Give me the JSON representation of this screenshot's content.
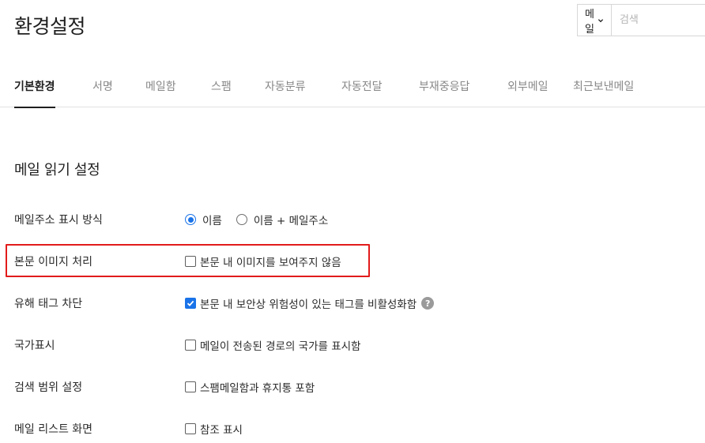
{
  "header": {
    "title": "환경설정",
    "search": {
      "scope_selected": "메일",
      "placeholder": "검색",
      "value": ""
    }
  },
  "tabs": [
    {
      "label": "기본환경",
      "active": true
    },
    {
      "label": "서명",
      "active": false
    },
    {
      "label": "메일함",
      "active": false
    },
    {
      "label": "스팸",
      "active": false
    },
    {
      "label": "자동분류",
      "active": false
    },
    {
      "label": "자동전달",
      "active": false
    },
    {
      "label": "부재중응답",
      "active": false
    },
    {
      "label": "외부메일",
      "active": false
    },
    {
      "label": "최근보낸메일",
      "active": false
    }
  ],
  "section": {
    "title": "메일 읽기 설정",
    "rows": [
      {
        "label": "메일주소 표시 방식",
        "radios": [
          {
            "label": "이름",
            "checked": true
          },
          {
            "label": "이름 + 메일주소",
            "checked": false
          }
        ]
      },
      {
        "label": "본문 이미지 처리",
        "option": "본문 내 이미지를 보여주지 않음",
        "checked": false,
        "highlighted": true
      },
      {
        "label": "유해 태그 차단",
        "option": "본문 내 보안상 위험성이 있는 태그를 비활성화함",
        "checked": true,
        "help": "?"
      },
      {
        "label": "국가표시",
        "option": "메일이 전송된 경로의 국가를 표시함",
        "checked": false
      },
      {
        "label": "검색 범위 설정",
        "option": "스팸메일함과 휴지통 포함",
        "checked": false
      },
      {
        "label": "메일 리스트 화면",
        "option": "참조 표시",
        "checked": false
      }
    ]
  },
  "colors": {
    "accent": "#1a73e8",
    "highlight": "#e21b1b",
    "muted_text": "#888888"
  }
}
